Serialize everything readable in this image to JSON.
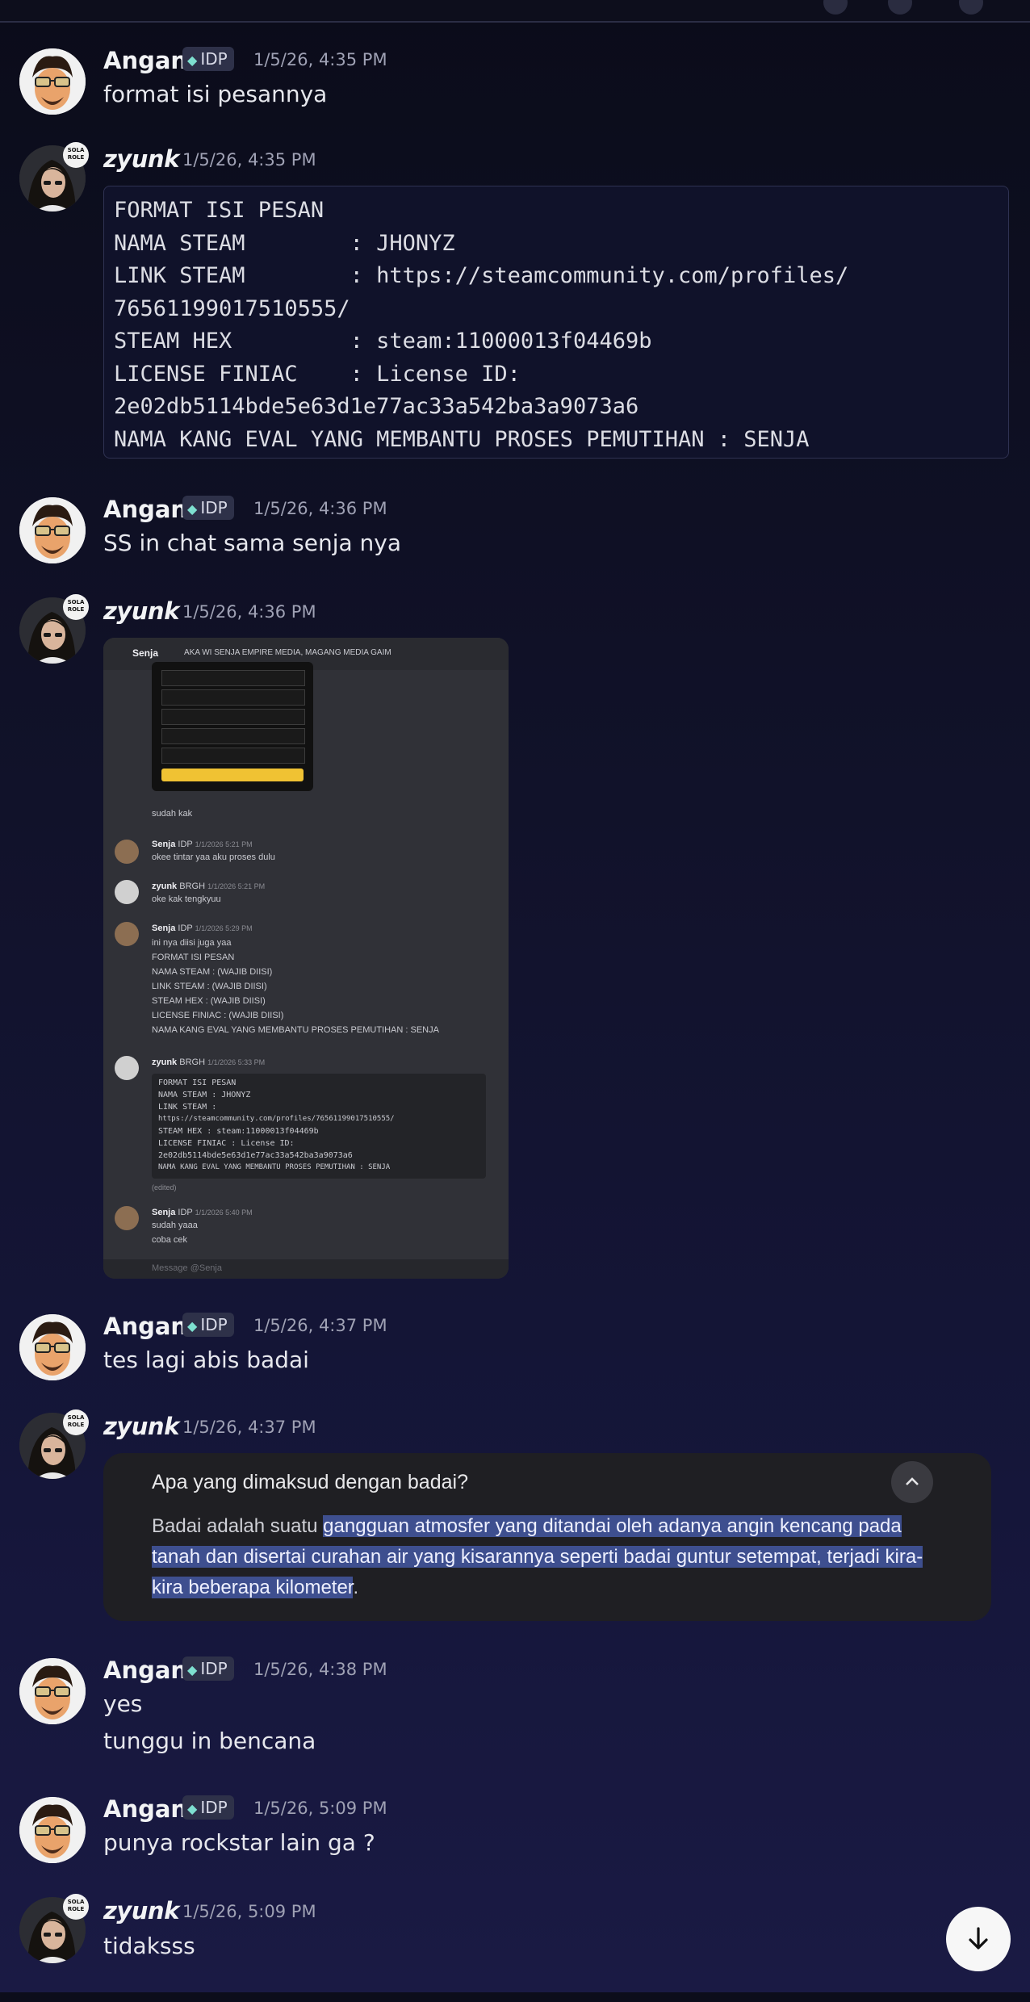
{
  "topbar": {
    "hint": ""
  },
  "angan": {
    "name": "Angan",
    "role_tag": "IDP"
  },
  "zyunk": {
    "name": "zyunk",
    "badge": "SOLA ROLE"
  },
  "messages": {
    "m1": {
      "time": "1/5/26, 4:35 PM",
      "text": "format isi pesannya"
    },
    "m2": {
      "time": "1/5/26, 4:35 PM",
      "code": "FORMAT ISI PESAN\nNAMA STEAM        : JHONYZ\nLINK STEAM        : https://steamcommunity.com/profiles/\n76561199017510555/\nSTEAM HEX         : steam:11000013f04469b\nLICENSE FINIAC    : License ID:\n2e02db5114bde5e63d1e77ac33a542ba3a9073a6\nNAMA KANG EVAL YANG MEMBANTU PROSES PEMUTIHAN : SENJA"
    },
    "m3": {
      "time": "1/5/26, 4:36 PM",
      "text": "SS in chat sama senja nya"
    },
    "m4": {
      "time": "1/5/26, 4:36 PM",
      "screenshot": {
        "header_name": "Senja",
        "header_channels": "AKA   WI   SENJA  EMPIRE MEDIA, MAGANG   MEDIA GAIM",
        "l1": "sudah kak",
        "l2_name": "Senja",
        "l2_tag": "IDP",
        "l2_time": "1/1/2026 5:21 PM",
        "l2_text": "okee tintar yaa aku proses dulu",
        "l3_name": "zyunk",
        "l3_tag": "BRGH",
        "l3_time": "1/1/2026 5:21 PM",
        "l3_text": "oke kak tengkyuu",
        "l4_name": "Senja",
        "l4_tag": "IDP",
        "l4_time": "1/1/2026 5:29 PM",
        "l4_lines": [
          "ini nya diisi juga yaa",
          "FORMAT ISI PESAN",
          "NAMA STEAM      : (WAJIB DIISI)",
          "LINK STEAM      : (WAJIB DIISI)",
          "STEAM HEX       : (WAJIB DIISI)",
          "LICENSE FINIAC  : (WAJIB DIISI)",
          "NAMA KANG EVAL YANG MEMBANTU PROSES PEMUTIHAN : SENJA"
        ],
        "l5_name": "zyunk",
        "l5_tag": "BRGH",
        "l5_time": "1/1/2026 5:33 PM",
        "l5_code": [
          "FORMAT ISI PESAN",
          "NAMA STEAM        : JHONYZ",
          "LINK STEAM        :",
          "https://steamcommunity.com/profiles/76561199017510555/",
          "STEAM HEX         : steam:11000013f04469b",
          "LICENSE FINIAC    : License ID:",
          "2e02db5114bde5e63d1e77ac33a542ba3a9073a6",
          "NAMA KANG EVAL YANG MEMBANTU PROSES PEMUTIHAN : SENJA"
        ],
        "l5_edited": "(edited)",
        "l6_name": "Senja",
        "l6_tag": "IDP",
        "l6_time": "1/1/2026 5:40 PM",
        "l6_lines": [
          "sudah yaaa",
          "coba cek"
        ],
        "composer": "Message @Senja"
      }
    },
    "m5": {
      "time": "1/5/26, 4:37 PM",
      "text": "tes lagi abis badai"
    },
    "m6": {
      "time": "1/5/26, 4:37 PM",
      "question": "Apa yang dimaksud dengan badai?",
      "answer_line1_plain": "Badai adalah suatu ",
      "answer_line1_hl": "gangguan atmosfer yang ditandai oleh adanya angin kencang pada",
      "answer_line2_hl": "tanah dan disertai curahan air yang kisarannya seperti badai guntur setempat, terjadi kira-",
      "answer_line3_hl": "kira beberapa kilometer",
      "answer_line3_plain": "."
    },
    "m7": {
      "time": "1/5/26, 4:38 PM",
      "line1": "yes",
      "line2": "tunggu in bencana"
    },
    "m8": {
      "time": "1/5/26, 5:09 PM",
      "text": "punya rockstar lain ga ?"
    },
    "m9": {
      "time": "1/5/26, 5:09 PM",
      "text": "tidaksss"
    }
  },
  "icons": {
    "gem": "gem-icon",
    "collapse": "chevron-up-icon",
    "scroll": "arrow-down-icon"
  },
  "colors": {
    "background": "#11122a",
    "highlight": "#3e4f8f",
    "tag": "#2e3149"
  }
}
